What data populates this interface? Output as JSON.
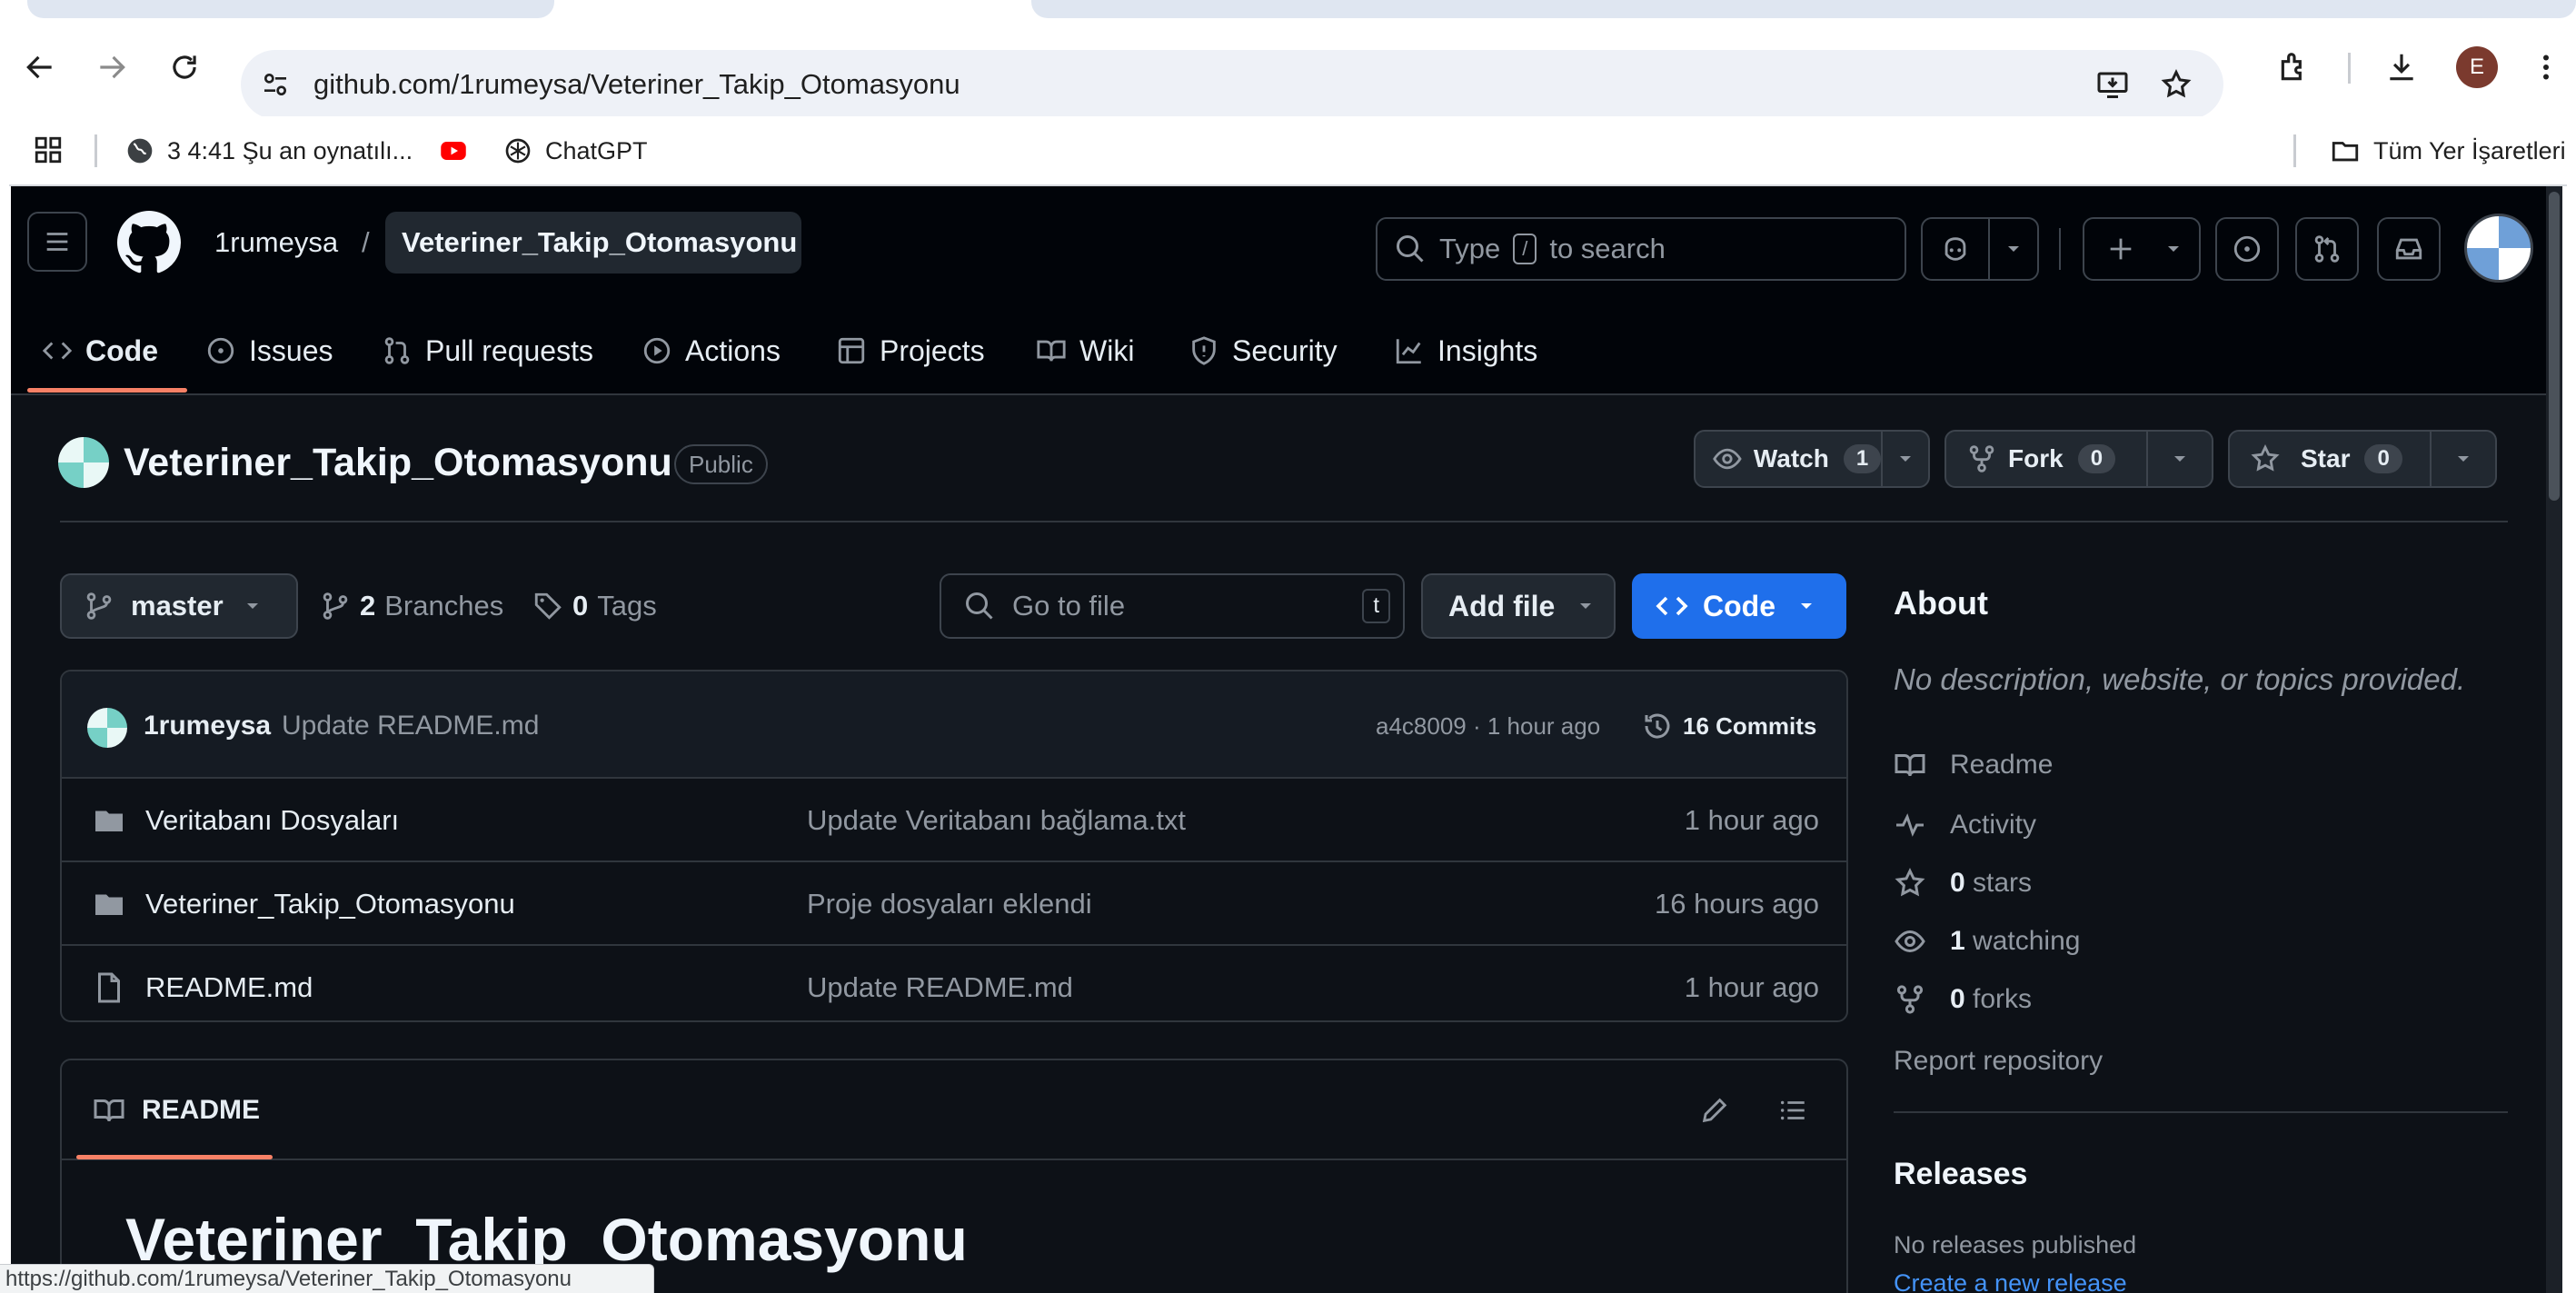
{
  "browser": {
    "url": "github.com/1rumeysa/Veteriner_Takip_Otomasyonu",
    "profile_initial": "E",
    "bookmarks": [
      {
        "icon": "globe-icon",
        "label": "3 4:41 Şu an oynatılı..."
      },
      {
        "icon": "youtube-icon",
        "label": ""
      },
      {
        "icon": "chatgpt-icon",
        "label": "ChatGPT"
      }
    ],
    "all_bookmarks_label": "Tüm Yer İşaretleri"
  },
  "header": {
    "owner": "1rumeysa",
    "separator": "/",
    "repo": "Veteriner_Takip_Otomasyonu",
    "search_pre": "Type",
    "search_key": "/",
    "search_post": "to search"
  },
  "tabs": [
    {
      "icon": "code-icon",
      "label": "Code",
      "active": true
    },
    {
      "icon": "issues-icon",
      "label": "Issues"
    },
    {
      "icon": "pull-request-icon",
      "label": "Pull requests"
    },
    {
      "icon": "actions-icon",
      "label": "Actions"
    },
    {
      "icon": "projects-icon",
      "label": "Projects"
    },
    {
      "icon": "wiki-icon",
      "label": "Wiki"
    },
    {
      "icon": "security-icon",
      "label": "Security"
    },
    {
      "icon": "insights-icon",
      "label": "Insights"
    }
  ],
  "repo": {
    "name": "Veteriner_Takip_Otomasyonu",
    "visibility": "Public",
    "watch_label": "Watch",
    "watch_count": "1",
    "fork_label": "Fork",
    "fork_count": "0",
    "star_label": "Star",
    "star_count": "0"
  },
  "toolbar": {
    "branch": "master",
    "branches_count": "2",
    "branches_label": "Branches",
    "tags_count": "0",
    "tags_label": "Tags",
    "goto_placeholder": "Go to file",
    "goto_key": "t",
    "add_file_label": "Add file",
    "code_label": "Code"
  },
  "commit": {
    "author": "1rumeysa",
    "message": "Update README.md",
    "meta": "a4c8009 · 1 hour ago",
    "commits_label": "16 Commits"
  },
  "files": [
    {
      "type": "folder",
      "name": "Veritabanı Dosyaları",
      "message": "Update Veritabanı bağlama.txt",
      "time": "1 hour ago"
    },
    {
      "type": "folder",
      "name": "Veteriner_Takip_Otomasyonu",
      "message": "Proje dosyaları eklendi",
      "time": "16 hours ago"
    },
    {
      "type": "file",
      "name": "README.md",
      "message": "Update README.md",
      "time": "1 hour ago"
    }
  ],
  "readme": {
    "tab_label": "README",
    "heading": "Veteriner_Takip_Otomasyonu"
  },
  "about": {
    "title": "About",
    "description": "No description, website, or topics provided.",
    "readme": "Readme",
    "activity": "Activity",
    "stars_count": "0",
    "stars_label": "stars",
    "watching_count": "1",
    "watching_label": "watching",
    "forks_count": "0",
    "forks_label": "forks",
    "report": "Report repository"
  },
  "releases": {
    "title": "Releases",
    "none": "No releases published",
    "create": "Create a new release"
  },
  "status_url": "https://github.com/1rumeysa/Veteriner_Takip_Otomasyonu",
  "colors": {
    "accent_blue": "#1f6feb",
    "active_tab_underline": "#f78166",
    "link": "#4493f8",
    "background": "#0d1117"
  }
}
